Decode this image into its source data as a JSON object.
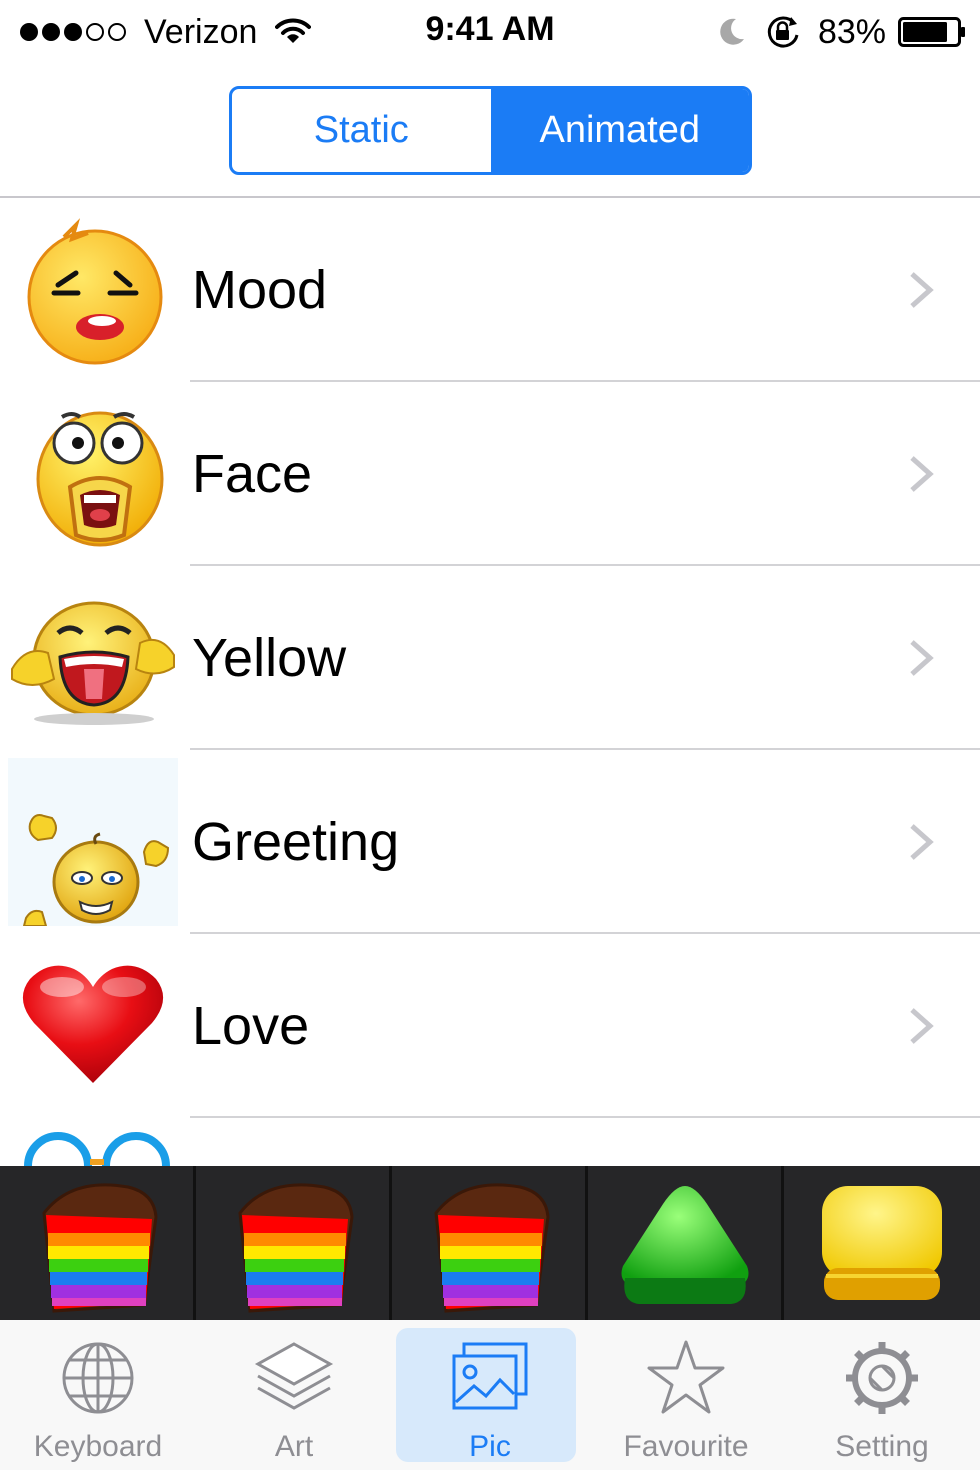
{
  "status_bar": {
    "carrier": "Verizon",
    "time": "9:41 AM",
    "battery": "83%",
    "battery_level": 0.83
  },
  "segmented": {
    "options": [
      "Static",
      "Animated"
    ],
    "selected": "Animated"
  },
  "categories": [
    {
      "label": "Mood",
      "icon": "sleepy-emoji-icon"
    },
    {
      "label": "Face",
      "icon": "screaming-emoji-icon"
    },
    {
      "label": "Yellow",
      "icon": "laughing-emoji-icon"
    },
    {
      "label": "Greeting",
      "icon": "waving-emoji-icon"
    },
    {
      "label": "Love",
      "icon": "red-heart-icon"
    }
  ],
  "banner": {
    "items": [
      "rainbow-cake-icon",
      "rainbow-cake-icon",
      "rainbow-cake-icon",
      "green-candy-icon",
      "yellow-candy-icon"
    ]
  },
  "tab_bar": {
    "tabs": [
      {
        "label": "Keyboard",
        "icon": "globe-icon"
      },
      {
        "label": "Art",
        "icon": "layers-icon"
      },
      {
        "label": "Pic",
        "icon": "picture-icon"
      },
      {
        "label": "Favourite",
        "icon": "star-icon"
      },
      {
        "label": "Setting",
        "icon": "gear-icon"
      }
    ],
    "selected": "Pic"
  },
  "colors": {
    "accent": "#1b7cf5",
    "separator": "#d3d3d6",
    "tab_inactive": "#8e8e93",
    "tab_highlight": "#d7e9fb"
  }
}
